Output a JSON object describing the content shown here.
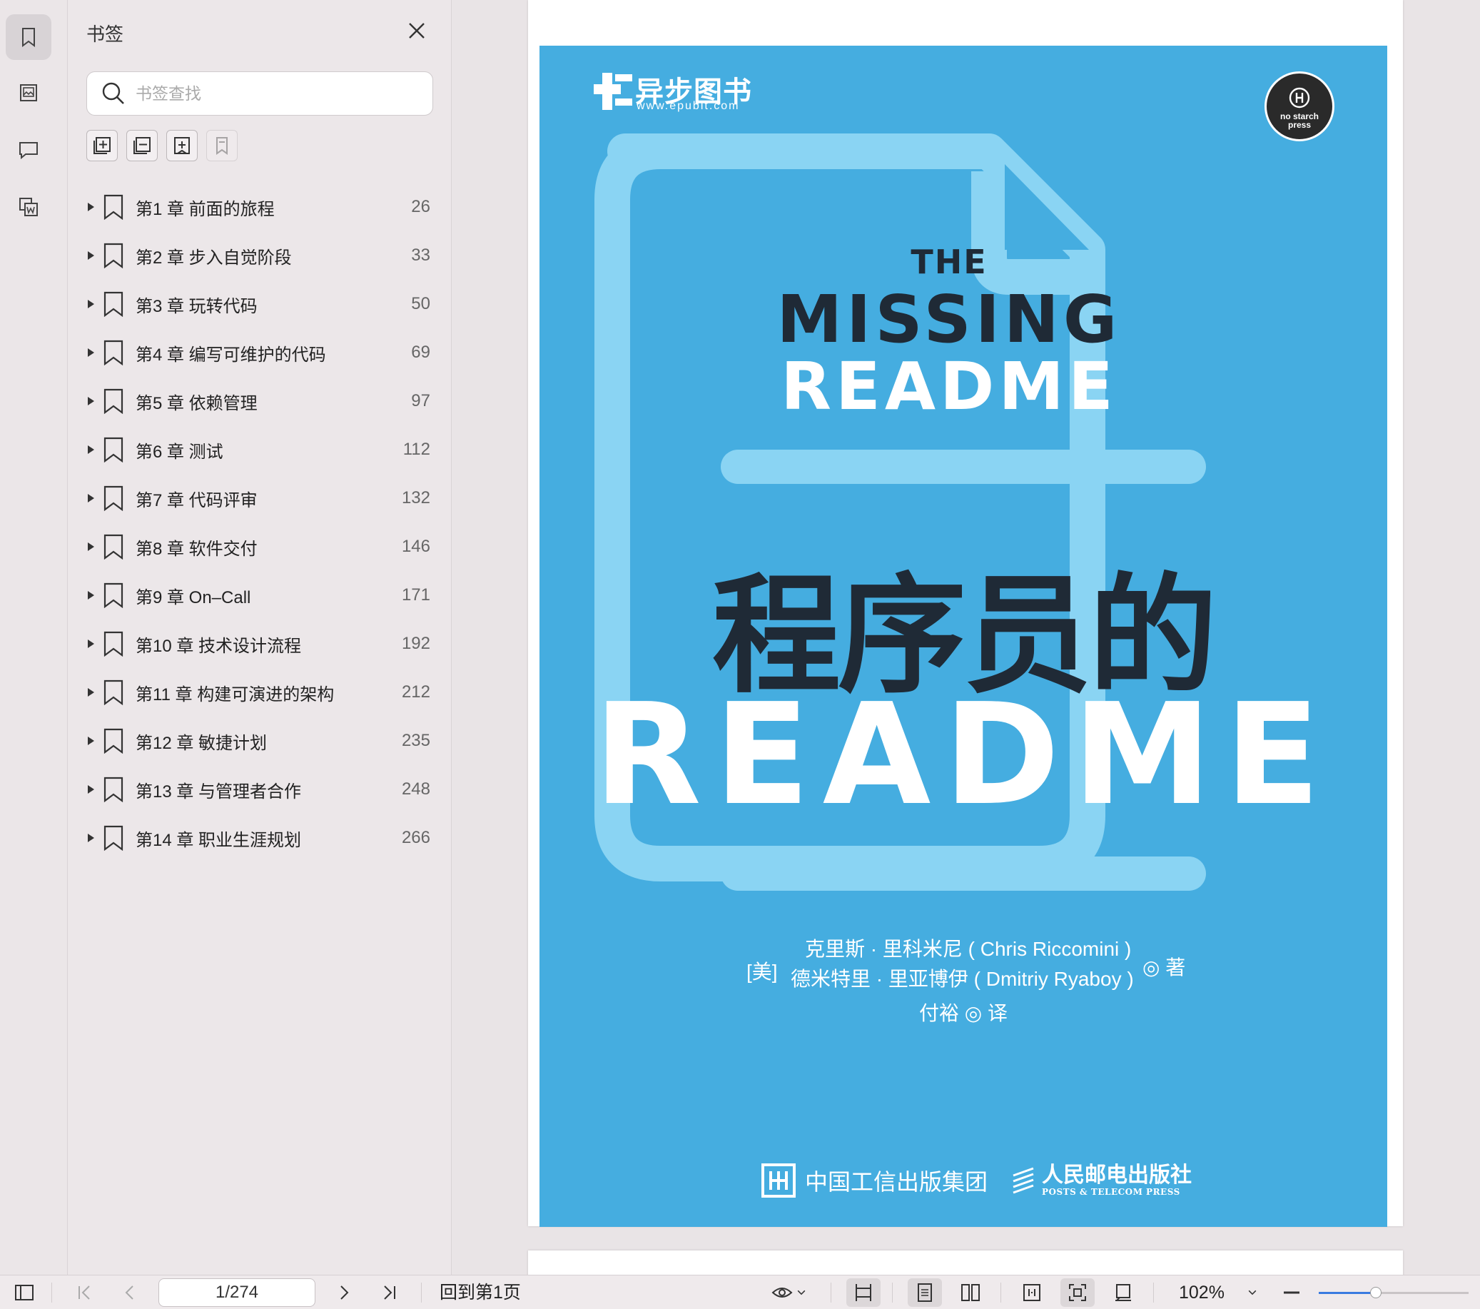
{
  "panel": {
    "title": "书签",
    "search_placeholder": "书签查找"
  },
  "bookmarks": [
    {
      "label": "第1 章 前面的旅程",
      "page": "26"
    },
    {
      "label": "第2 章 步入自觉阶段",
      "page": "33"
    },
    {
      "label": "第3 章 玩转代码",
      "page": "50"
    },
    {
      "label": "第4 章 编写可维护的代码",
      "page": "69"
    },
    {
      "label": "第5 章 依赖管理",
      "page": "97"
    },
    {
      "label": "第6 章 测试",
      "page": "112"
    },
    {
      "label": "第7 章 代码评审",
      "page": "132"
    },
    {
      "label": "第8 章 软件交付",
      "page": "146"
    },
    {
      "label": "第9 章 On–Call",
      "page": "171"
    },
    {
      "label": "第10 章 技术设计流程",
      "page": "192"
    },
    {
      "label": "第11 章 构建可演进的架构",
      "page": "212"
    },
    {
      "label": "第12 章 敏捷计划",
      "page": "235"
    },
    {
      "label": "第13 章 与管理者合作",
      "page": "248"
    },
    {
      "label": "第14 章 职业生涯规划",
      "page": "266"
    }
  ],
  "cover": {
    "logo_cn": "异步图书",
    "logo_url": "www.epubit.com",
    "badge": "no starch press",
    "the": "THE",
    "missing": "MISSING",
    "readme_small": "README",
    "title_cn": "程序员的",
    "title_readme": "README",
    "author_prefix": "[美]",
    "author1": "克里斯 · 里科米尼 ( Chris Riccomini )",
    "author2": "德米特里 · 里亚博伊 ( Dmitriy Ryaboy )",
    "author_suffix": "◎ 著",
    "translator": "付裕 ◎ 译",
    "publisher1": "中国工信出版集团",
    "publisher2_cn": "人民邮电出版社",
    "publisher2_en": "POSTS & TELECOM PRESS"
  },
  "statusbar": {
    "page_value": "1/274",
    "back_first": "回到第1页",
    "zoom": "102%",
    "zoom_fraction": 0.38
  },
  "colors": {
    "cover_bg": "#45ade0",
    "cover_frame": "#8ad4f3",
    "title_dark": "#1f2a36",
    "accent": "#3a7be0"
  }
}
